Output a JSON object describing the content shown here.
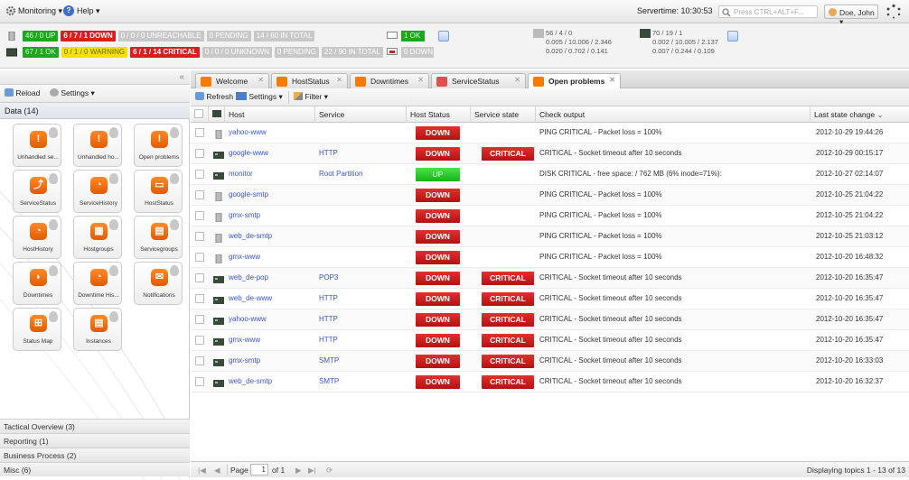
{
  "topbar": {
    "monitoring_label": "Monitoring",
    "help_label": "Help",
    "servertime": "Servertime: 10:30:53",
    "search_placeholder": "Press CTRL+ALT+F...",
    "user_label": "Doe, John"
  },
  "status": {
    "hosts_row": [
      {
        "text": "46 / 0 UP",
        "color": "green"
      },
      {
        "text": "6 / 7 / 1 DOWN",
        "color": "red"
      },
      {
        "text": "0 / 0 / 0 UNREACHABLE",
        "color": "gray"
      },
      {
        "text": "0 PENDING",
        "color": "gray"
      },
      {
        "text": "14 / 60 IN TOTAL",
        "color": "gray"
      }
    ],
    "services_row": [
      {
        "text": "67 / 1 OK",
        "color": "green"
      },
      {
        "text": "0 / 1 / 0 WARNING",
        "color": "yellow"
      },
      {
        "text": "6 / 1 / 14 CRITICAL",
        "color": "red"
      },
      {
        "text": "0 / 0 / 0 UNKNOWN",
        "color": "gray"
      },
      {
        "text": "0 PENDING",
        "color": "gray"
      },
      {
        "text": "22 / 90 IN TOTAL",
        "color": "gray"
      }
    ],
    "ok_box": "1 OK",
    "down_box": "0 DOWN",
    "metrics_left": [
      "56 / 4 / 0",
      "0.005 / 10.006 / 2.346",
      "0.020 / 0.702 / 0.141"
    ],
    "metrics_right": [
      "70 / 19 / 1",
      "0.002 / 10.005 / 2.137",
      "0.007 / 0.244 / 0.109"
    ]
  },
  "left": {
    "reload_label": "Reload",
    "settings_label": "Settings",
    "data_header": "Data (14)",
    "tiles": [
      {
        "label": "Unhandled se...",
        "glyph": "!"
      },
      {
        "label": "Unhandled ho...",
        "glyph": "!"
      },
      {
        "label": "Open problems",
        "glyph": "!"
      },
      {
        "label": "ServiceStatus",
        "glyph": "⤴"
      },
      {
        "label": "ServiceHistory",
        "glyph": "◔"
      },
      {
        "label": "HostStatus",
        "glyph": "▭"
      },
      {
        "label": "HostHistory",
        "glyph": "◔"
      },
      {
        "label": "Hostgroups",
        "glyph": "▦"
      },
      {
        "label": "Servicegroups",
        "glyph": "▤"
      },
      {
        "label": "Downtimes",
        "glyph": "◗"
      },
      {
        "label": "Downtime His...",
        "glyph": "◔"
      },
      {
        "label": "Notifications",
        "glyph": "✉"
      },
      {
        "label": "Status Map",
        "glyph": "⊞"
      },
      {
        "label": "Instances",
        "glyph": "▤"
      }
    ],
    "accordion": [
      "Tactical Overview (3)",
      "Reporting (1)",
      "Business Process (2)",
      "Misc (6)"
    ]
  },
  "tabs": [
    {
      "label": "Welcome"
    },
    {
      "label": "HostStatus"
    },
    {
      "label": "Downtimes"
    },
    {
      "label": "ServiceStatus"
    },
    {
      "label": "Open problems"
    }
  ],
  "grid": {
    "refresh_label": "Refresh",
    "settings_label": "Settings",
    "filter_label": "Filter",
    "columns": [
      "Host",
      "Service",
      "Host Status",
      "Service state",
      "Check output",
      "Last state change"
    ],
    "rows": [
      {
        "host": "yahoo-www",
        "service": "",
        "host_status": "DOWN",
        "service_state": "",
        "output": "PING CRITICAL - Packet loss = 100%",
        "changed": "2012-10-29 19:44:26"
      },
      {
        "host": "google-www",
        "service": "HTTP",
        "host_status": "DOWN",
        "service_state": "CRITICAL",
        "output": "CRITICAL - Socket timeout after 10 seconds",
        "changed": "2012-10-29 00:15:17"
      },
      {
        "host": "monitor",
        "service": "Root Partition",
        "host_status": "UP",
        "service_state": "",
        "output": "DISK CRITICAL - free space: / 762 MB (6% inode=71%):",
        "changed": "2012-10-27 02:14:07"
      },
      {
        "host": "google-smtp",
        "service": "",
        "host_status": "DOWN",
        "service_state": "",
        "output": "PING CRITICAL - Packet loss = 100%",
        "changed": "2012-10-25 21:04:22"
      },
      {
        "host": "gmx-smtp",
        "service": "",
        "host_status": "DOWN",
        "service_state": "",
        "output": "PING CRITICAL - Packet loss = 100%",
        "changed": "2012-10-25 21:04:22"
      },
      {
        "host": "web_de-smtp",
        "service": "",
        "host_status": "DOWN",
        "service_state": "",
        "output": "PING CRITICAL - Packet loss = 100%",
        "changed": "2012-10-25 21:03:12"
      },
      {
        "host": "gmx-www",
        "service": "",
        "host_status": "DOWN",
        "service_state": "",
        "output": "PING CRITICAL - Packet loss = 100%",
        "changed": "2012-10-20 16:48:32"
      },
      {
        "host": "web_de-pop",
        "service": "POP3",
        "host_status": "DOWN",
        "service_state": "CRITICAL",
        "output": "CRITICAL - Socket timeout after 10 seconds",
        "changed": "2012-10-20 16:35:47"
      },
      {
        "host": "web_de-www",
        "service": "HTTP",
        "host_status": "DOWN",
        "service_state": "CRITICAL",
        "output": "CRITICAL - Socket timeout after 10 seconds",
        "changed": "2012-10-20 16:35:47"
      },
      {
        "host": "yahoo-www",
        "service": "HTTP",
        "host_status": "DOWN",
        "service_state": "CRITICAL",
        "output": "CRITICAL - Socket timeout after 10 seconds",
        "changed": "2012-10-20 16:35:47"
      },
      {
        "host": "gmx-www",
        "service": "HTTP",
        "host_status": "DOWN",
        "service_state": "CRITICAL",
        "output": "CRITICAL - Socket timeout after 10 seconds",
        "changed": "2012-10-20 16:35:47"
      },
      {
        "host": "gmx-smtp",
        "service": "SMTP",
        "host_status": "DOWN",
        "service_state": "CRITICAL",
        "output": "CRITICAL - Socket timeout after 10 seconds",
        "changed": "2012-10-20 16:33:03"
      },
      {
        "host": "web_de-smtp",
        "service": "SMTP",
        "host_status": "DOWN",
        "service_state": "CRITICAL",
        "output": "CRITICAL - Socket timeout after 10 seconds",
        "changed": "2012-10-20 16:32:37"
      }
    ]
  },
  "pager": {
    "page_label": "Page",
    "page_value": "1",
    "of_label": "of 1",
    "display": "Displaying topics 1 - 13 of 13"
  }
}
